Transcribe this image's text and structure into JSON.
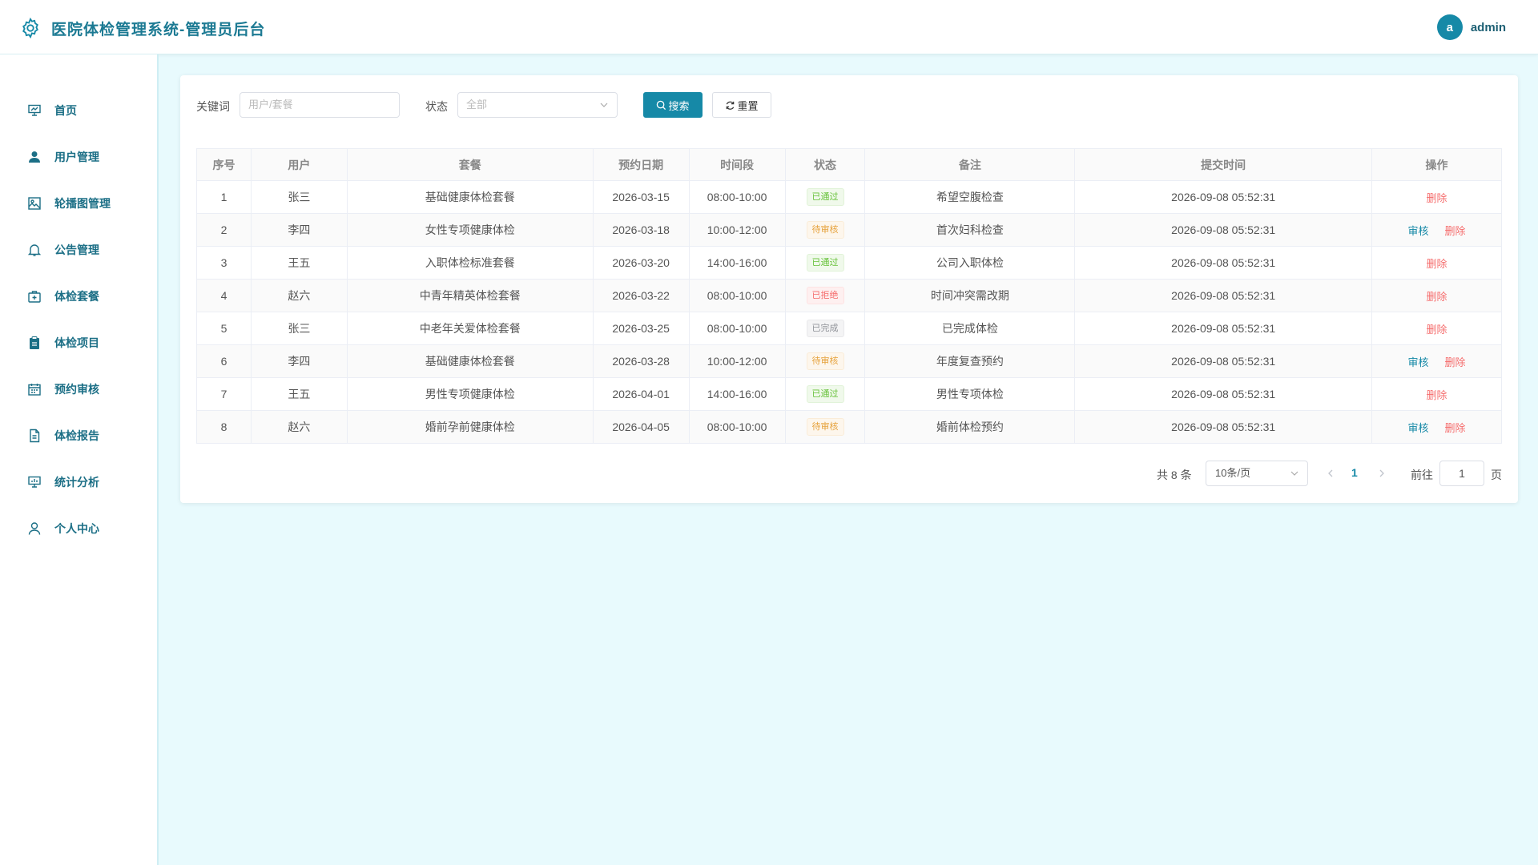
{
  "header": {
    "title": "医院体检管理系统-管理员后台",
    "avatar_letter": "a",
    "username": "admin"
  },
  "sidebar": {
    "items": [
      {
        "label": "首页",
        "icon": "dashboard-icon"
      },
      {
        "label": "用户管理",
        "icon": "user-icon"
      },
      {
        "label": "轮播图管理",
        "icon": "picture-icon"
      },
      {
        "label": "公告管理",
        "icon": "bell-icon"
      },
      {
        "label": "体检套餐",
        "icon": "medical-box-icon"
      },
      {
        "label": "体检项目",
        "icon": "clipboard-icon"
      },
      {
        "label": "预约审核",
        "icon": "calendar-icon"
      },
      {
        "label": "体检报告",
        "icon": "document-icon"
      },
      {
        "label": "统计分析",
        "icon": "chart-board-icon"
      },
      {
        "label": "个人中心",
        "icon": "person-outline-icon"
      }
    ]
  },
  "filters": {
    "keyword_label": "关键词",
    "keyword_placeholder": "用户/套餐",
    "status_label": "状态",
    "status_value": "全部",
    "search_label": "搜索",
    "reset_label": "重置"
  },
  "table": {
    "columns": [
      "序号",
      "用户",
      "套餐",
      "预约日期",
      "时间段",
      "状态",
      "备注",
      "提交时间",
      "操作"
    ],
    "rows": [
      {
        "no": "1",
        "user": "张三",
        "package": "基础健康体检套餐",
        "date": "2026-03-15",
        "slot": "08:00-10:00",
        "status": "已通过",
        "status_type": "success",
        "note": "希望空腹检查",
        "submitted": "2026-09-08 05:52:31",
        "can_review": false
      },
      {
        "no": "2",
        "user": "李四",
        "package": "女性专项健康体检",
        "date": "2026-03-18",
        "slot": "10:00-12:00",
        "status": "待审核",
        "status_type": "warning",
        "note": "首次妇科检查",
        "submitted": "2026-09-08 05:52:31",
        "can_review": true
      },
      {
        "no": "3",
        "user": "王五",
        "package": "入职体检标准套餐",
        "date": "2026-03-20",
        "slot": "14:00-16:00",
        "status": "已通过",
        "status_type": "success",
        "note": "公司入职体检",
        "submitted": "2026-09-08 05:52:31",
        "can_review": false
      },
      {
        "no": "4",
        "user": "赵六",
        "package": "中青年精英体检套餐",
        "date": "2026-03-22",
        "slot": "08:00-10:00",
        "status": "已拒绝",
        "status_type": "danger",
        "note": "时间冲突需改期",
        "submitted": "2026-09-08 05:52:31",
        "can_review": false
      },
      {
        "no": "5",
        "user": "张三",
        "package": "中老年关爱体检套餐",
        "date": "2026-03-25",
        "slot": "08:00-10:00",
        "status": "已完成",
        "status_type": "info",
        "note": "已完成体检",
        "submitted": "2026-09-08 05:52:31",
        "can_review": false
      },
      {
        "no": "6",
        "user": "李四",
        "package": "基础健康体检套餐",
        "date": "2026-03-28",
        "slot": "10:00-12:00",
        "status": "待审核",
        "status_type": "warning",
        "note": "年度复查预约",
        "submitted": "2026-09-08 05:52:31",
        "can_review": true
      },
      {
        "no": "7",
        "user": "王五",
        "package": "男性专项健康体检",
        "date": "2026-04-01",
        "slot": "14:00-16:00",
        "status": "已通过",
        "status_type": "success",
        "note": "男性专项体检",
        "submitted": "2026-09-08 05:52:31",
        "can_review": false
      },
      {
        "no": "8",
        "user": "赵六",
        "package": "婚前孕前健康体检",
        "date": "2026-04-05",
        "slot": "08:00-10:00",
        "status": "待审核",
        "status_type": "warning",
        "note": "婚前体检预约",
        "submitted": "2026-09-08 05:52:31",
        "can_review": true
      }
    ],
    "review_label": "审核",
    "delete_label": "删除"
  },
  "pagination": {
    "total_text": "共 8 条",
    "page_size": "10条/页",
    "current_page": "1",
    "goto_label": "前往",
    "goto_value": "1",
    "page_unit": "页"
  },
  "colors": {
    "accent": "#1689a7",
    "background": "#e8fafd",
    "success": "#67c23a",
    "warning": "#e6a23c",
    "danger": "#f56c6c",
    "info": "#909399"
  }
}
